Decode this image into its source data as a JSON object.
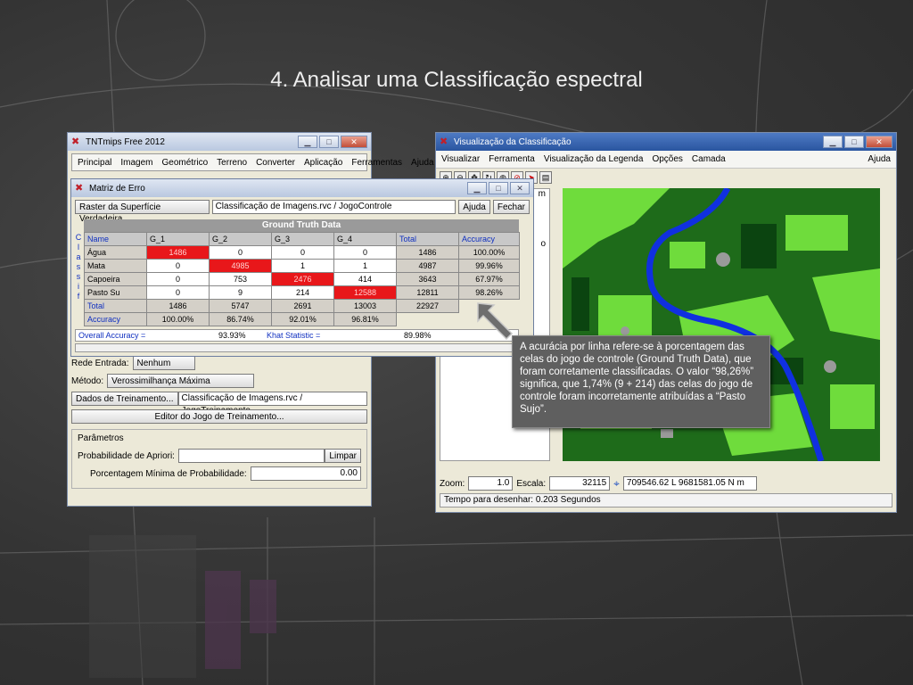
{
  "slide": {
    "title": "4. Analisar uma Classificação espectral"
  },
  "tnt": {
    "title": "TNTmips Free 2012",
    "menu": [
      "Principal",
      "Imagem",
      "Geométrico",
      "Terreno",
      "Converter",
      "Aplicação",
      "Ferramentas",
      "Ajuda"
    ],
    "rede_label": "Rede Entrada:",
    "rede_value": "Nenhum",
    "metodo_label": "Método:",
    "metodo_value": "Verossimilhança Máxima",
    "dados_button": "Dados de Treinamento...",
    "dados_value": "Classificação de Imagens.rvc / JogoTreinamento",
    "editor_button": "Editor do Jogo de Treinamento...",
    "params_label": "Parâmetros",
    "prob_label": "Probabilidade de Apriori:",
    "limpar": "Limpar",
    "pct_label": "Porcentagem Mínima de Probabilidade:",
    "pct_value": "0.00"
  },
  "matriz": {
    "title": "Matriz de Erro",
    "raster_button": "Raster da Superfície Verdadeira ...",
    "raster_value": "Classificação de Imagens.rvc / JogoControle",
    "ajuda": "Ajuda",
    "fechar": "Fechar",
    "gt_header": "Ground Truth Data",
    "classe_letters": [
      "C",
      "l",
      "a",
      "s",
      "s",
      "i",
      "f"
    ],
    "columns": [
      "Name",
      "G_1",
      "G_2",
      "G_3",
      "G_4",
      "Total",
      "Accuracy"
    ],
    "rows": [
      {
        "name": "Água",
        "cells": [
          "1486",
          "0",
          "0",
          "0"
        ],
        "total": "1486",
        "acc": "100.00%"
      },
      {
        "name": "Mata",
        "cells": [
          "0",
          "4985",
          "1",
          "1"
        ],
        "total": "4987",
        "acc": "99.96%"
      },
      {
        "name": "Capoeira",
        "cells": [
          "0",
          "753",
          "2476",
          "414"
        ],
        "total": "3643",
        "acc": "67.97%"
      },
      {
        "name": "Pasto Su",
        "cells": [
          "0",
          "9",
          "214",
          "12588"
        ],
        "total": "12811",
        "acc": "98.26%"
      }
    ],
    "total_row": {
      "name": "Total",
      "cells": [
        "1486",
        "5747",
        "2691",
        "13003"
      ],
      "total": "22927"
    },
    "accuracy_row": {
      "name": "Accuracy",
      "cells": [
        "100.00%",
        "86.74%",
        "92.01%",
        "96.81%"
      ]
    },
    "overall_label": "Overall Accuracy =",
    "overall_value": "93.93%",
    "khat_label": "Khat Statistic =",
    "khat_value": "89.98%"
  },
  "viz": {
    "title": "Visualização da Classificação",
    "menu": [
      "Visualizar",
      "Ferramenta",
      "Visualização da Legenda",
      "Opções",
      "Camada"
    ],
    "menu_right": "Ajuda",
    "zoom_label": "Zoom:",
    "zoom_value": "1.0",
    "escala_label": "Escala:",
    "escala_value": "32115",
    "coords": "709546.62 L  9681581.05 N m",
    "status": "Tempo para desenhar: 0.203 Segundos",
    "side_letters": [
      "m",
      "o"
    ]
  },
  "callout": {
    "text": "A acurácia por linha refere-se à porcentagem das celas do jogo de controle (Ground Truth Data), que foram corretamente classificadas. O valor “98,26%” significa, que 1,74% (9 + 214) das celas do jogo de controle foram incorretamente atribuídas a “Pasto Sujo”."
  },
  "colors": {
    "red_cell": "#e8171a",
    "river": "#1030e0",
    "map_green_dark": "#1e6b1a",
    "map_green_light": "#6fdc3c"
  }
}
